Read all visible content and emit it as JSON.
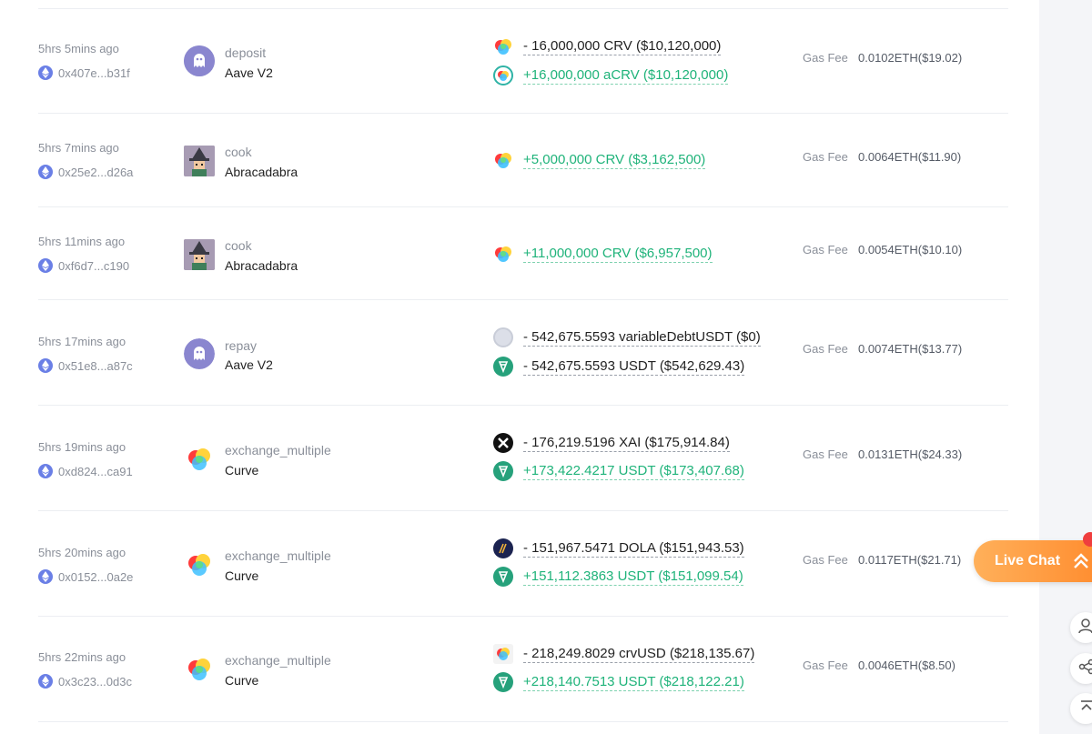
{
  "transactions": [
    {
      "time": "5hrs 5mins ago",
      "hash": "0x407e...b31f",
      "method": "deposit",
      "protocol": "Aave V2",
      "protocol_icon": "aave-ghost-icon",
      "tokens": [
        {
          "text": "- 16,000,000 CRV ($10,120,000)",
          "direction": "out",
          "icon": "crv-token-icon"
        },
        {
          "text": "+16,000,000 aCRV ($10,120,000)",
          "direction": "in",
          "icon": "acrv-token-icon"
        }
      ],
      "gas_label": "Gas Fee",
      "gas_value": "0.0102ETH($19.02)"
    },
    {
      "time": "5hrs 7mins ago",
      "hash": "0x25e2...d26a",
      "method": "cook",
      "protocol": "Abracadabra",
      "protocol_icon": "abracadabra-wizard-icon",
      "tokens": [
        {
          "text": "+5,000,000 CRV ($3,162,500)",
          "direction": "in",
          "icon": "crv-token-icon"
        }
      ],
      "gas_label": "Gas Fee",
      "gas_value": "0.0064ETH($11.90)"
    },
    {
      "time": "5hrs 11mins ago",
      "hash": "0xf6d7...c190",
      "method": "cook",
      "protocol": "Abracadabra",
      "protocol_icon": "abracadabra-wizard-icon",
      "tokens": [
        {
          "text": "+11,000,000 CRV ($6,957,500)",
          "direction": "in",
          "icon": "crv-token-icon"
        }
      ],
      "gas_label": "Gas Fee",
      "gas_value": "0.0054ETH($10.10)"
    },
    {
      "time": "5hrs 17mins ago",
      "hash": "0x51e8...a87c",
      "method": "repay",
      "protocol": "Aave V2",
      "protocol_icon": "aave-ghost-icon",
      "tokens": [
        {
          "text": "- 542,675.5593 variableDebtUSDT ($0)",
          "direction": "out",
          "icon": "debt-token-icon"
        },
        {
          "text": "- 542,675.5593 USDT ($542,629.43)",
          "direction": "out",
          "icon": "usdt-token-icon"
        }
      ],
      "gas_label": "Gas Fee",
      "gas_value": "0.0074ETH($13.77)"
    },
    {
      "time": "5hrs 19mins ago",
      "hash": "0xd824...ca91",
      "method": "exchange_multiple",
      "protocol": "Curve",
      "protocol_icon": "curve-logo-icon",
      "tokens": [
        {
          "text": "- 176,219.5196 XAI ($175,914.84)",
          "direction": "out",
          "icon": "xai-token-icon"
        },
        {
          "text": "+173,422.4217 USDT ($173,407.68)",
          "direction": "in",
          "icon": "usdt-token-icon"
        }
      ],
      "gas_label": "Gas Fee",
      "gas_value": "0.0131ETH($24.33)"
    },
    {
      "time": "5hrs 20mins ago",
      "hash": "0x0152...0a2e",
      "method": "exchange_multiple",
      "protocol": "Curve",
      "protocol_icon": "curve-logo-icon",
      "tokens": [
        {
          "text": "- 151,967.5471 DOLA ($151,943.53)",
          "direction": "out",
          "icon": "dola-token-icon"
        },
        {
          "text": "+151,112.3863 USDT ($151,099.54)",
          "direction": "in",
          "icon": "usdt-token-icon"
        }
      ],
      "gas_label": "Gas Fee",
      "gas_value": "0.0117ETH($21.71)"
    },
    {
      "time": "5hrs 22mins ago",
      "hash": "0x3c23...0d3c",
      "method": "exchange_multiple",
      "protocol": "Curve",
      "protocol_icon": "curve-logo-icon",
      "tokens": [
        {
          "text": "- 218,249.8029 crvUSD ($218,135.67)",
          "direction": "out",
          "icon": "crvusd-token-icon"
        },
        {
          "text": "+218,140.7513 USDT ($218,122.21)",
          "direction": "in",
          "icon": "usdt-token-icon"
        }
      ],
      "gas_label": "Gas Fee",
      "gas_value": "0.0046ETH($8.50)"
    }
  ],
  "live_chat": {
    "label": "Live Chat",
    "icon": "double-chevron-up-icon"
  },
  "side_buttons": [
    "person-icon",
    "share-icon",
    "back-to-top-icon"
  ],
  "colors": {
    "in": "#1fb37a",
    "out": "#222222",
    "muted": "#8a8f99",
    "live_chat": "#ff9a3c"
  }
}
